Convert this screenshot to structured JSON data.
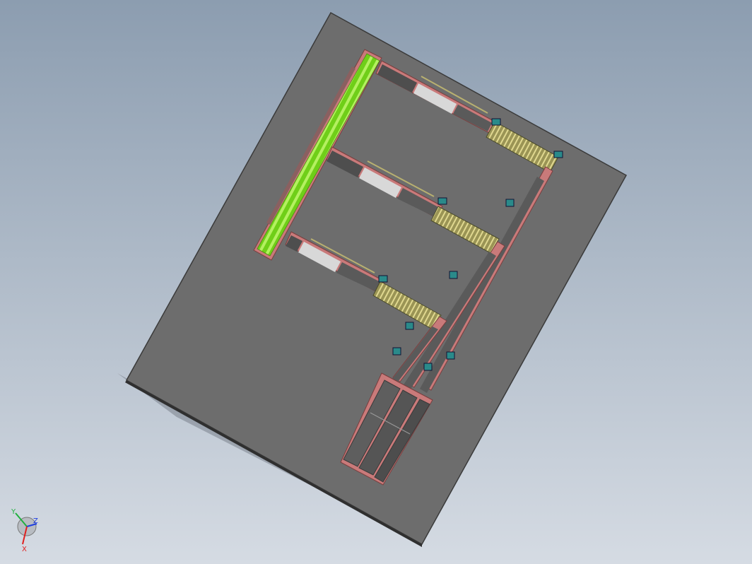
{
  "scene": {
    "colors": {
      "background_top": "#8c9db0",
      "background_bottom": "#d5dbe3",
      "floor_plate": "#6e6e6e",
      "conveyor_frame": "#c97a7a",
      "roller_belt_green": "#7ddc1f",
      "transfer_unit": "#b8b070",
      "motor": "#2a8a8a",
      "outfeed_chute": "#5a5a5a"
    },
    "objects": {
      "floor_plate": "floor-plate",
      "infeed_roller_conveyor": "green-roller-conveyor",
      "branch_conveyors": [
        "branch-conveyor-top",
        "branch-conveyor-middle",
        "branch-conveyor-bottom"
      ],
      "transfer_units": [
        "transfer-unit-1",
        "transfer-unit-2",
        "transfer-unit-3"
      ],
      "collector_conveyors": [
        "collector-conveyor-1",
        "collector-conveyor-2",
        "collector-conveyor-3"
      ],
      "outfeed_lanes": [
        "outfeed-lane-1",
        "outfeed-lane-2",
        "outfeed-lane-3"
      ]
    }
  },
  "triad": {
    "x_label": "X",
    "y_label": "Y",
    "z_label": "Z",
    "x_color": "#e02020",
    "y_color": "#20b040",
    "z_color": "#2040e0"
  }
}
